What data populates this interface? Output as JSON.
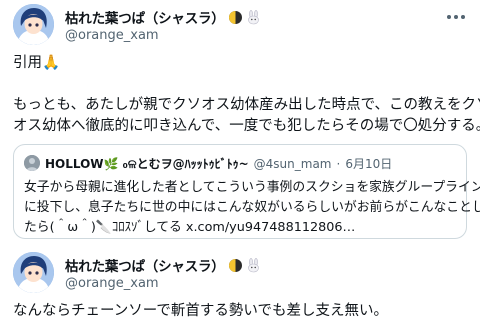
{
  "post1": {
    "display_name": "枯れた葉つぱ（シャスラ）",
    "handle": "@orange_xam",
    "line_a": "引用🙏",
    "line_b": "もっとも、あたしが親でクソオス幼体産み出した時点で、この教えをクソ",
    "line_c": "オス幼体へ徹底的に叩き込んで、一度でも犯したらその場で〇処分する。",
    "more_label": "···"
  },
  "quote": {
    "display_name": "HOLLOW🌿 ₀ଳとむヲ@ﾊｯｯﾄｩﾋﾞﾄｩ~",
    "handle": "@4sun_mam",
    "date": "6月10日",
    "line_1": "女子から母親に進化した者としてこういう事例のスクショを家族グループライン",
    "line_2": "に投下し、息子たちに世の中にはこんな奴がいるらしいがお前らがこんなことし",
    "line_3": "たら(＾ω＾)🔪ｺﾛｽｿﾞしてる x.com/yu947488112806…"
  },
  "post2": {
    "display_name": "枯れた葉つぱ（シャスラ）",
    "handle": "@orange_xam",
    "line_a": "なんならチェーンソーで斬首する勢いでも差し支え無い。"
  },
  "icons": {
    "moon": "half-moon-icon",
    "rabbit": "rabbit-icon",
    "more": "more-options-icon"
  },
  "colors": {
    "text": "#0f1419",
    "secondary": "#536471",
    "border": "#cfd9de"
  }
}
